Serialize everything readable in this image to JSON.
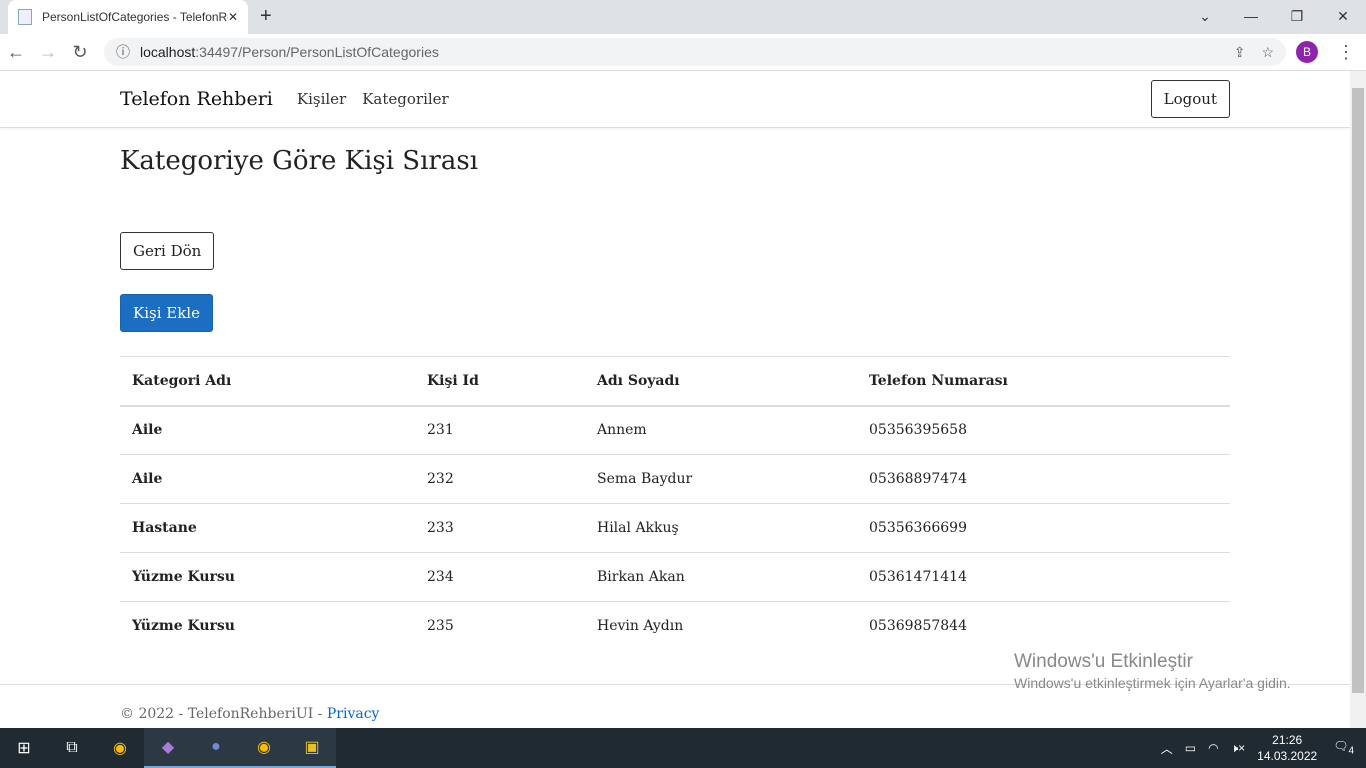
{
  "browser": {
    "tab_title": "PersonListOfCategories - TelefonRehberiUI",
    "url_host": "localhost",
    "url_rest": ":34497/Person/PersonListOfCategories",
    "profile_initial": "B"
  },
  "nav": {
    "brand": "Telefon Rehberi",
    "links": [
      "Kişiler",
      "Kategoriler"
    ],
    "logout": "Logout"
  },
  "main": {
    "title": "Kategoriye Göre Kişi Sırası",
    "back_label": "Geri Dön",
    "add_label": "Kişi Ekle",
    "columns": [
      "Kategori Adı",
      "Kişi Id",
      "Adı Soyadı",
      "Telefon Numarası"
    ],
    "rows": [
      [
        "Aile",
        "231",
        "Annem",
        "05356395658"
      ],
      [
        "Aile",
        "232",
        "Sema Baydur",
        "05368897474"
      ],
      [
        "Hastane",
        "233",
        "Hilal Akkuş",
        "05356366699"
      ],
      [
        "Yüzme Kursu",
        "234",
        "Birkan Akan",
        "05361471414"
      ],
      [
        "Yüzme Kursu",
        "235",
        "Hevin Aydın",
        "05369857844"
      ]
    ]
  },
  "footer": {
    "text": "© 2022 - TelefonRehberiUI - ",
    "privacy": "Privacy"
  },
  "watermark": {
    "title": "Windows'u Etkinleştir",
    "subtitle": "Windows'u etkinleştirmek için Ayarlar'a gidin."
  },
  "taskbar": {
    "time": "21:26",
    "date": "14.03.2022",
    "notifications": "4"
  },
  "colors": {
    "primary": "#1b6ec2",
    "link": "#0366d6",
    "taskbar": "#1f2a33"
  }
}
